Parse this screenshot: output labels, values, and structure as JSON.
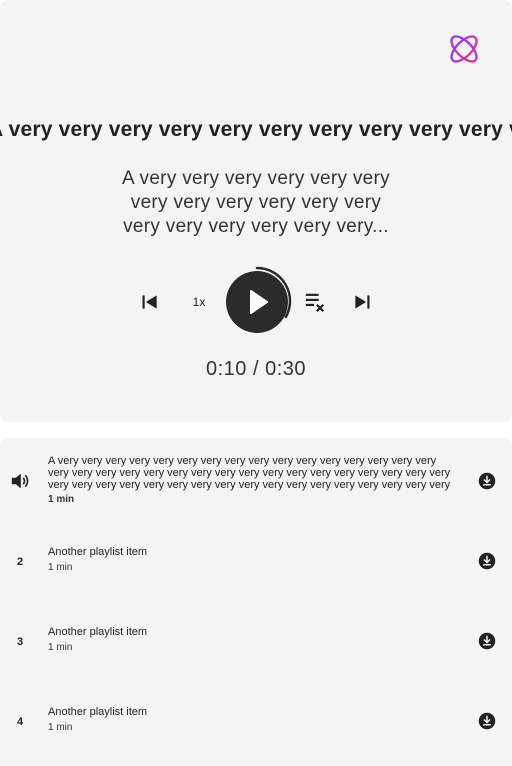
{
  "player": {
    "scroll_title": "A very very very very very very very very very very very very very very very very very very very very very",
    "subtitle_lines": [
      "A very very very very very very",
      "very very very very very very",
      "very very very very very very..."
    ],
    "speed_label": "1x",
    "time_display": "0:10 / 0:30",
    "progress_fraction": 0.33,
    "accent_colors": [
      "#8a3ffc",
      "#e4388a"
    ],
    "icons": {
      "prev": "skip-previous-icon",
      "play": "play-icon",
      "clear_queue": "playlist-remove-icon",
      "next": "skip-next-icon"
    }
  },
  "playlist": {
    "items": [
      {
        "index_icon": "volume-icon",
        "title": "A very very very very very very very very very very very very very very very very very very very very very very very very very very very very very very very very very very very very very very very very very very very very very very very very very very very very very...",
        "duration": "1 min",
        "active": true
      },
      {
        "index": "2",
        "title": "Another playlist item",
        "duration": "1 min"
      },
      {
        "index": "3",
        "title": "Another playlist item",
        "duration": "1 min"
      },
      {
        "index": "4",
        "title": "Another playlist item",
        "duration": "1 min"
      }
    ]
  }
}
